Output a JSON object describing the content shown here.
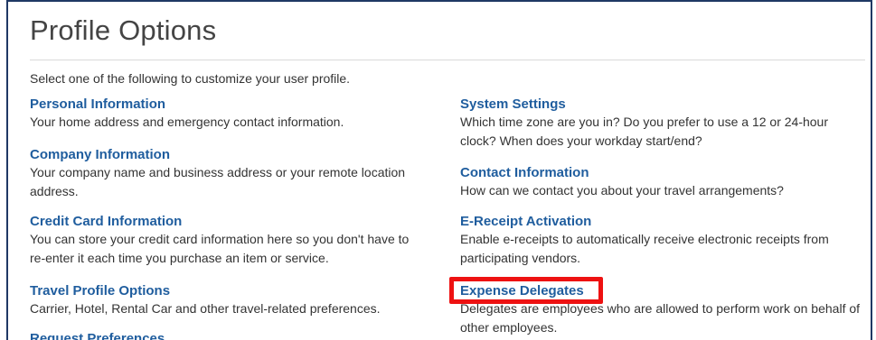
{
  "page": {
    "title": "Profile Options",
    "intro": "Select one of the following to customize your user profile."
  },
  "left_options": [
    {
      "label": "Personal Information",
      "description": "Your home address and emergency contact information."
    },
    {
      "label": "Company Information",
      "description": "Your company name and business address or your remote location address."
    },
    {
      "label": "Credit Card Information",
      "description": "You can store your credit card information here so you don't have to re-enter it each time you purchase an item or service."
    },
    {
      "label": "Travel Profile Options",
      "description": "Carrier, Hotel, Rental Car and other travel-related preferences."
    },
    {
      "label": "Request Preferences",
      "description": ""
    }
  ],
  "right_options": [
    {
      "label": "System Settings",
      "description": "Which time zone are you in? Do you prefer to use a 12 or 24-hour clock? When does your workday start/end?"
    },
    {
      "label": "Contact Information",
      "description": "How can we contact you about your travel arrangements?"
    },
    {
      "label": "E-Receipt Activation",
      "description": "Enable e-receipts to automatically receive electronic receipts from participating vendors."
    },
    {
      "label": "Expense Delegates",
      "description": "Delegates are employees who are allowed to perform work on behalf of other employees."
    }
  ],
  "colors": {
    "link": "#1f5d9e",
    "highlight": "#ee1111",
    "frame": "#1f3864"
  }
}
